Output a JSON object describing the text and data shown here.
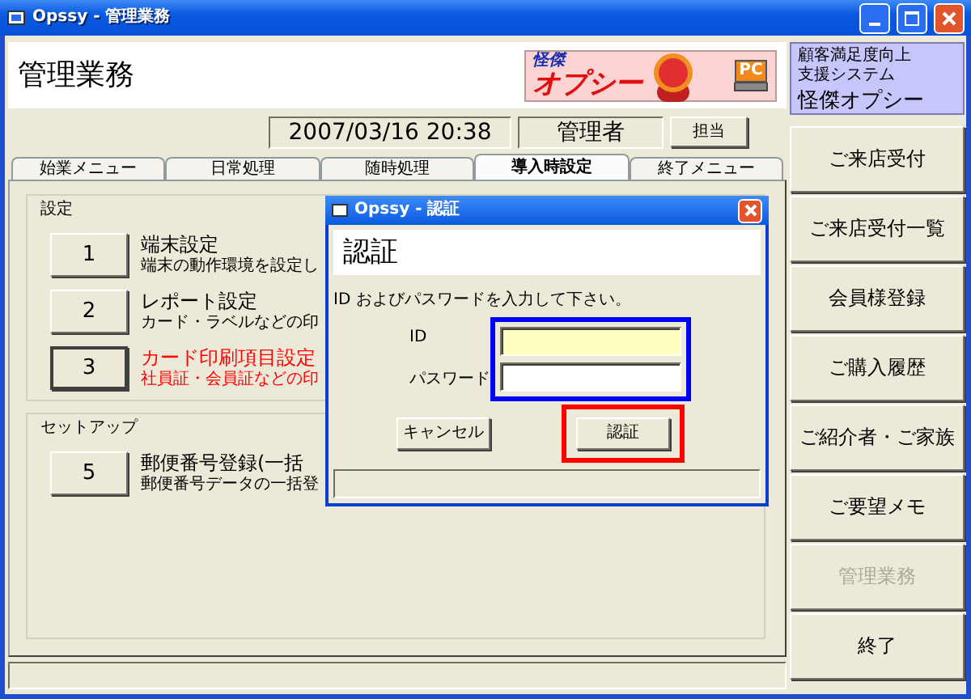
{
  "window": {
    "title": "Opssy - 管理業務"
  },
  "header": {
    "title": "管理業務",
    "logo": {
      "small_text": "怪傑",
      "name": "オプシー",
      "badge": "PC"
    }
  },
  "info_panel": {
    "lines": [
      "顧客満足度向上",
      "支援システム"
    ],
    "product": "怪傑オプシー"
  },
  "session": {
    "datetime": "2007/03/16 20:38",
    "user": "管理者",
    "button": "担当"
  },
  "tabs": [
    {
      "label": "始業メニュー",
      "selected": false
    },
    {
      "label": "日常処理",
      "selected": false
    },
    {
      "label": "随時処理",
      "selected": false
    },
    {
      "label": "導入時設定",
      "selected": true
    },
    {
      "label": "終了メニュー",
      "selected": false
    }
  ],
  "groups": [
    {
      "title": "設定",
      "items": [
        {
          "number": "1",
          "title": "端末設定",
          "description": "端末の動作環境を設定し",
          "color": "#000000",
          "focused": false
        },
        {
          "number": "2",
          "title": "レポート設定",
          "description": "カード・ラベルなどの印",
          "color": "#000000",
          "focused": false
        },
        {
          "number": "3",
          "title": "カード印刷項目設定",
          "description": "社員証・会員証などの印",
          "color": "#ff0000",
          "focused": true
        }
      ]
    },
    {
      "title": "セットアップ",
      "items": [
        {
          "number": "5",
          "title": "郵便番号登録(一括",
          "description": "郵便番号データの一括登",
          "color": "#000000",
          "focused": false
        }
      ]
    }
  ],
  "dialog": {
    "title": "Opssy - 認証",
    "heading": "認証",
    "prompt": "ID およびパスワードを入力して下さい。",
    "fields": [
      {
        "label": "ID",
        "focused": true
      },
      {
        "label": "パスワード",
        "focused": false
      }
    ],
    "fields_frame": {
      "color": "#0000ff"
    },
    "buttons": [
      {
        "label": "キャンセル"
      },
      {
        "label": "認証",
        "frame": {
          "color": "#ff0000"
        }
      }
    ]
  },
  "side_buttons": [
    {
      "label": "ご来店受付",
      "disabled": false
    },
    {
      "label": "ご来店受付一覧",
      "disabled": false
    },
    {
      "label": "会員様登録",
      "disabled": false
    },
    {
      "label": "ご購入履歴",
      "disabled": false
    },
    {
      "label": "ご紹介者・ご家族",
      "disabled": false
    },
    {
      "label": "ご要望メモ",
      "disabled": false
    },
    {
      "label": "管理業務",
      "disabled": true
    },
    {
      "label": "終了",
      "disabled": false
    }
  ]
}
